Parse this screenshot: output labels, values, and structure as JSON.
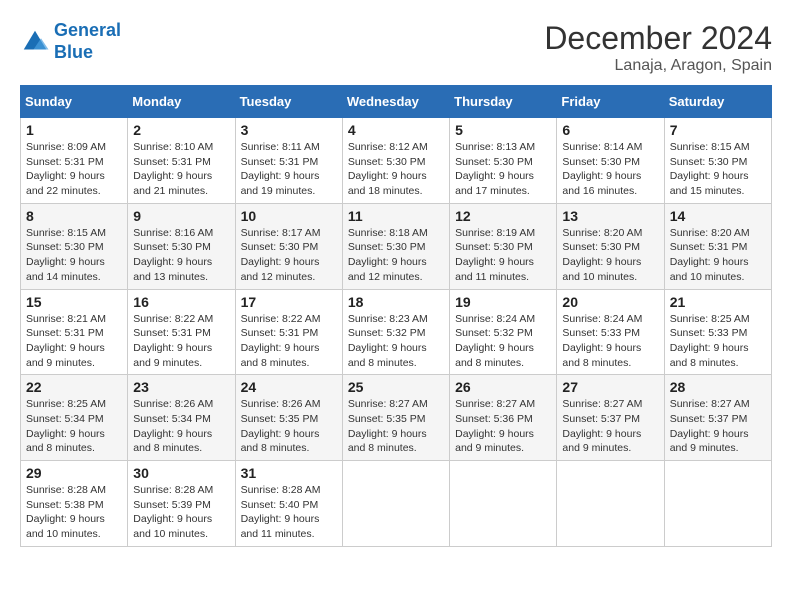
{
  "header": {
    "logo_line1": "General",
    "logo_line2": "Blue",
    "month": "December 2024",
    "location": "Lanaja, Aragon, Spain"
  },
  "weekdays": [
    "Sunday",
    "Monday",
    "Tuesday",
    "Wednesday",
    "Thursday",
    "Friday",
    "Saturday"
  ],
  "weeks": [
    [
      {
        "day": "1",
        "info": "Sunrise: 8:09 AM\nSunset: 5:31 PM\nDaylight: 9 hours\nand 22 minutes."
      },
      {
        "day": "2",
        "info": "Sunrise: 8:10 AM\nSunset: 5:31 PM\nDaylight: 9 hours\nand 21 minutes."
      },
      {
        "day": "3",
        "info": "Sunrise: 8:11 AM\nSunset: 5:31 PM\nDaylight: 9 hours\nand 19 minutes."
      },
      {
        "day": "4",
        "info": "Sunrise: 8:12 AM\nSunset: 5:30 PM\nDaylight: 9 hours\nand 18 minutes."
      },
      {
        "day": "5",
        "info": "Sunrise: 8:13 AM\nSunset: 5:30 PM\nDaylight: 9 hours\nand 17 minutes."
      },
      {
        "day": "6",
        "info": "Sunrise: 8:14 AM\nSunset: 5:30 PM\nDaylight: 9 hours\nand 16 minutes."
      },
      {
        "day": "7",
        "info": "Sunrise: 8:15 AM\nSunset: 5:30 PM\nDaylight: 9 hours\nand 15 minutes."
      }
    ],
    [
      {
        "day": "8",
        "info": "Sunrise: 8:15 AM\nSunset: 5:30 PM\nDaylight: 9 hours\nand 14 minutes."
      },
      {
        "day": "9",
        "info": "Sunrise: 8:16 AM\nSunset: 5:30 PM\nDaylight: 9 hours\nand 13 minutes."
      },
      {
        "day": "10",
        "info": "Sunrise: 8:17 AM\nSunset: 5:30 PM\nDaylight: 9 hours\nand 12 minutes."
      },
      {
        "day": "11",
        "info": "Sunrise: 8:18 AM\nSunset: 5:30 PM\nDaylight: 9 hours\nand 12 minutes."
      },
      {
        "day": "12",
        "info": "Sunrise: 8:19 AM\nSunset: 5:30 PM\nDaylight: 9 hours\nand 11 minutes."
      },
      {
        "day": "13",
        "info": "Sunrise: 8:20 AM\nSunset: 5:30 PM\nDaylight: 9 hours\nand 10 minutes."
      },
      {
        "day": "14",
        "info": "Sunrise: 8:20 AM\nSunset: 5:31 PM\nDaylight: 9 hours\nand 10 minutes."
      }
    ],
    [
      {
        "day": "15",
        "info": "Sunrise: 8:21 AM\nSunset: 5:31 PM\nDaylight: 9 hours\nand 9 minutes."
      },
      {
        "day": "16",
        "info": "Sunrise: 8:22 AM\nSunset: 5:31 PM\nDaylight: 9 hours\nand 9 minutes."
      },
      {
        "day": "17",
        "info": "Sunrise: 8:22 AM\nSunset: 5:31 PM\nDaylight: 9 hours\nand 8 minutes."
      },
      {
        "day": "18",
        "info": "Sunrise: 8:23 AM\nSunset: 5:32 PM\nDaylight: 9 hours\nand 8 minutes."
      },
      {
        "day": "19",
        "info": "Sunrise: 8:24 AM\nSunset: 5:32 PM\nDaylight: 9 hours\nand 8 minutes."
      },
      {
        "day": "20",
        "info": "Sunrise: 8:24 AM\nSunset: 5:33 PM\nDaylight: 9 hours\nand 8 minutes."
      },
      {
        "day": "21",
        "info": "Sunrise: 8:25 AM\nSunset: 5:33 PM\nDaylight: 9 hours\nand 8 minutes."
      }
    ],
    [
      {
        "day": "22",
        "info": "Sunrise: 8:25 AM\nSunset: 5:34 PM\nDaylight: 9 hours\nand 8 minutes."
      },
      {
        "day": "23",
        "info": "Sunrise: 8:26 AM\nSunset: 5:34 PM\nDaylight: 9 hours\nand 8 minutes."
      },
      {
        "day": "24",
        "info": "Sunrise: 8:26 AM\nSunset: 5:35 PM\nDaylight: 9 hours\nand 8 minutes."
      },
      {
        "day": "25",
        "info": "Sunrise: 8:27 AM\nSunset: 5:35 PM\nDaylight: 9 hours\nand 8 minutes."
      },
      {
        "day": "26",
        "info": "Sunrise: 8:27 AM\nSunset: 5:36 PM\nDaylight: 9 hours\nand 9 minutes."
      },
      {
        "day": "27",
        "info": "Sunrise: 8:27 AM\nSunset: 5:37 PM\nDaylight: 9 hours\nand 9 minutes."
      },
      {
        "day": "28",
        "info": "Sunrise: 8:27 AM\nSunset: 5:37 PM\nDaylight: 9 hours\nand 9 minutes."
      }
    ],
    [
      {
        "day": "29",
        "info": "Sunrise: 8:28 AM\nSunset: 5:38 PM\nDaylight: 9 hours\nand 10 minutes."
      },
      {
        "day": "30",
        "info": "Sunrise: 8:28 AM\nSunset: 5:39 PM\nDaylight: 9 hours\nand 10 minutes."
      },
      {
        "day": "31",
        "info": "Sunrise: 8:28 AM\nSunset: 5:40 PM\nDaylight: 9 hours\nand 11 minutes."
      },
      null,
      null,
      null,
      null
    ]
  ]
}
